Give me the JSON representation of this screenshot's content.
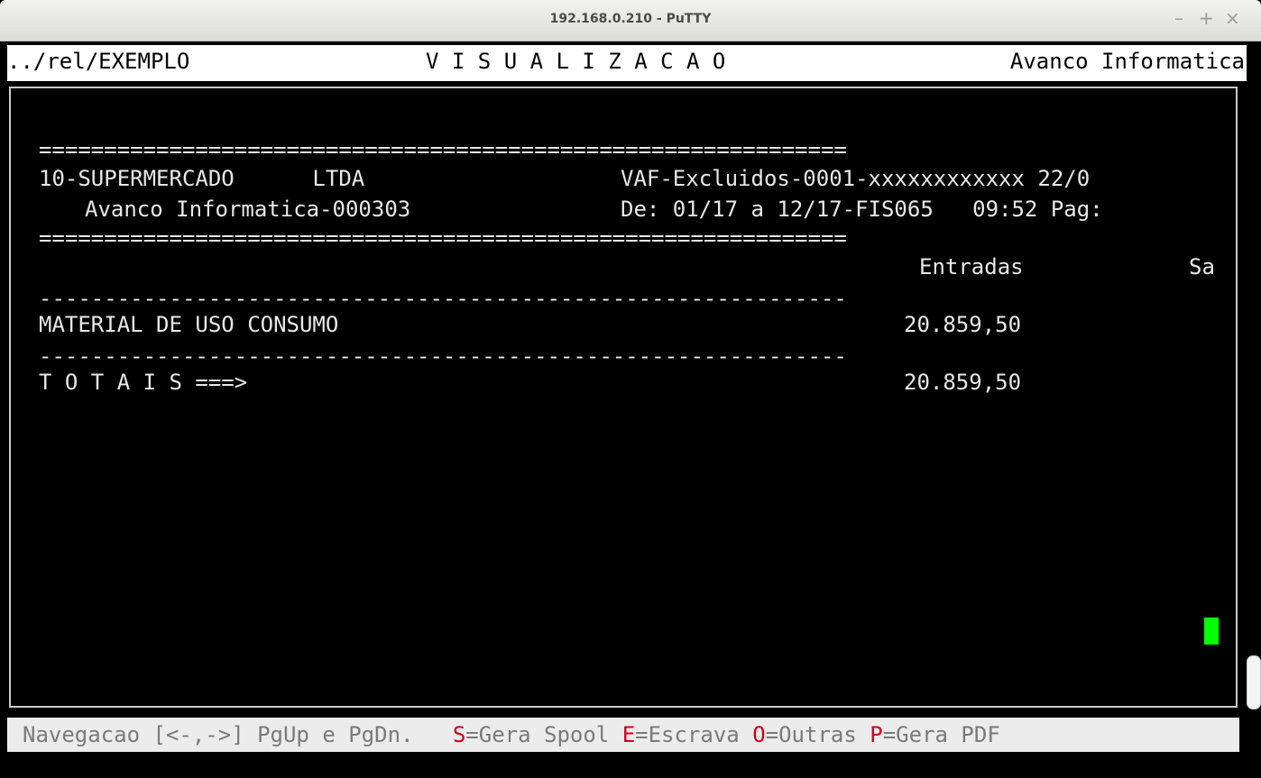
{
  "window": {
    "title": "192.168.0.210 - PuTTY",
    "min_glyph": "–",
    "max_glyph": "+",
    "close_glyph": "×"
  },
  "header": {
    "path": "../rel/EXEMPLO",
    "mode": "V I S U A L I Z A C A O",
    "company": "Avanco Informatica"
  },
  "report": {
    "rule_double": "==============================================================",
    "company_line": "10-SUPERMERCADO      LTDA",
    "report_id": "VAF-Excluidos-0001-xxxxxxxxxxxx 22/0",
    "vendor_line": "Avanco Informatica-000303",
    "period_line": "De: 01/17 a 12/17-FIS065   09:52 Pag:",
    "col_entradas": "Entradas",
    "col_saidas": "Sa",
    "rule_dash": "--------------------------------------------------------------",
    "rows": [
      {
        "label": "MATERIAL DE USO CONSUMO",
        "entradas": "20.859,50"
      }
    ],
    "totals": {
      "label": "T O T A I S ===>",
      "entradas": "20.859,50"
    }
  },
  "helpbar": {
    "nav": "Navegacao [<-,->] PgUp e PgDn.",
    "keys": [
      {
        "key": "S",
        "label": "=Gera Spool"
      },
      {
        "key": "E",
        "label": "=Escrava"
      },
      {
        "key": "O",
        "label": "=Outras"
      },
      {
        "key": "P",
        "label": "=Gera PDF"
      }
    ]
  },
  "colors": {
    "cursor": "#00ff00",
    "hotkey": "#d4001a",
    "terminal_bg": "#000000"
  }
}
